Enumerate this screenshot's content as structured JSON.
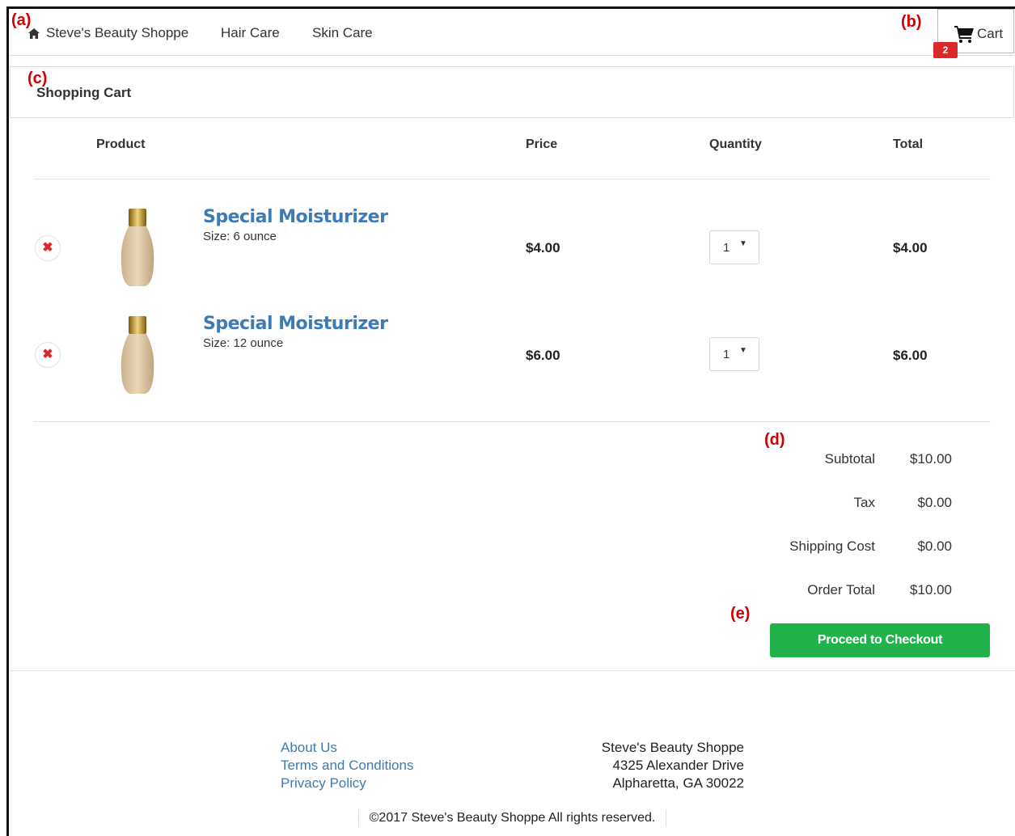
{
  "annotations": {
    "a": "(a)",
    "b": "(b)",
    "c": "(c)",
    "d": "(d)",
    "e": "(e)"
  },
  "navbar": {
    "brand": "Steve's Beauty Shoppe",
    "brand_icon": "home-icon",
    "links": [
      "Hair Care",
      "Skin Care"
    ],
    "cart_label": "Cart",
    "cart_icon": "shopping-cart-icon",
    "cart_count": "2"
  },
  "panel": {
    "title": "Shopping Cart"
  },
  "table": {
    "headers": {
      "product": "Product",
      "price": "Price",
      "quantity": "Quantity",
      "total": "Total"
    },
    "rows": [
      {
        "name": "Special Moisturizer",
        "size": "Size: 6 ounce",
        "price": "$4.00",
        "qty": "1",
        "total": "$4.00"
      },
      {
        "name": "Special Moisturizer",
        "size": "Size: 12 ounce",
        "price": "$6.00",
        "qty": "1",
        "total": "$6.00"
      }
    ],
    "remove_icon": "times-icon"
  },
  "summary": {
    "subtotal_label": "Subtotal",
    "subtotal": "$10.00",
    "tax_label": "Tax",
    "tax": "$0.00",
    "shipping_label": "Shipping Cost",
    "shipping": "$0.00",
    "order_total_label": "Order Total",
    "order_total": "$10.00",
    "checkout_label": "Proceed to Checkout"
  },
  "footer": {
    "links": [
      "About Us",
      "Terms and Conditions",
      "Privacy Policy"
    ],
    "address": [
      "Steve's Beauty Shoppe",
      "4325 Alexander Drive",
      "Alpharetta, GA 30022"
    ],
    "copyright": "©2017 Steve's Beauty Shoppe All rights reserved."
  },
  "colors": {
    "accent_link": "#3d7bb6",
    "checkout_green": "#22b24c",
    "badge_red": "#d9292b"
  }
}
